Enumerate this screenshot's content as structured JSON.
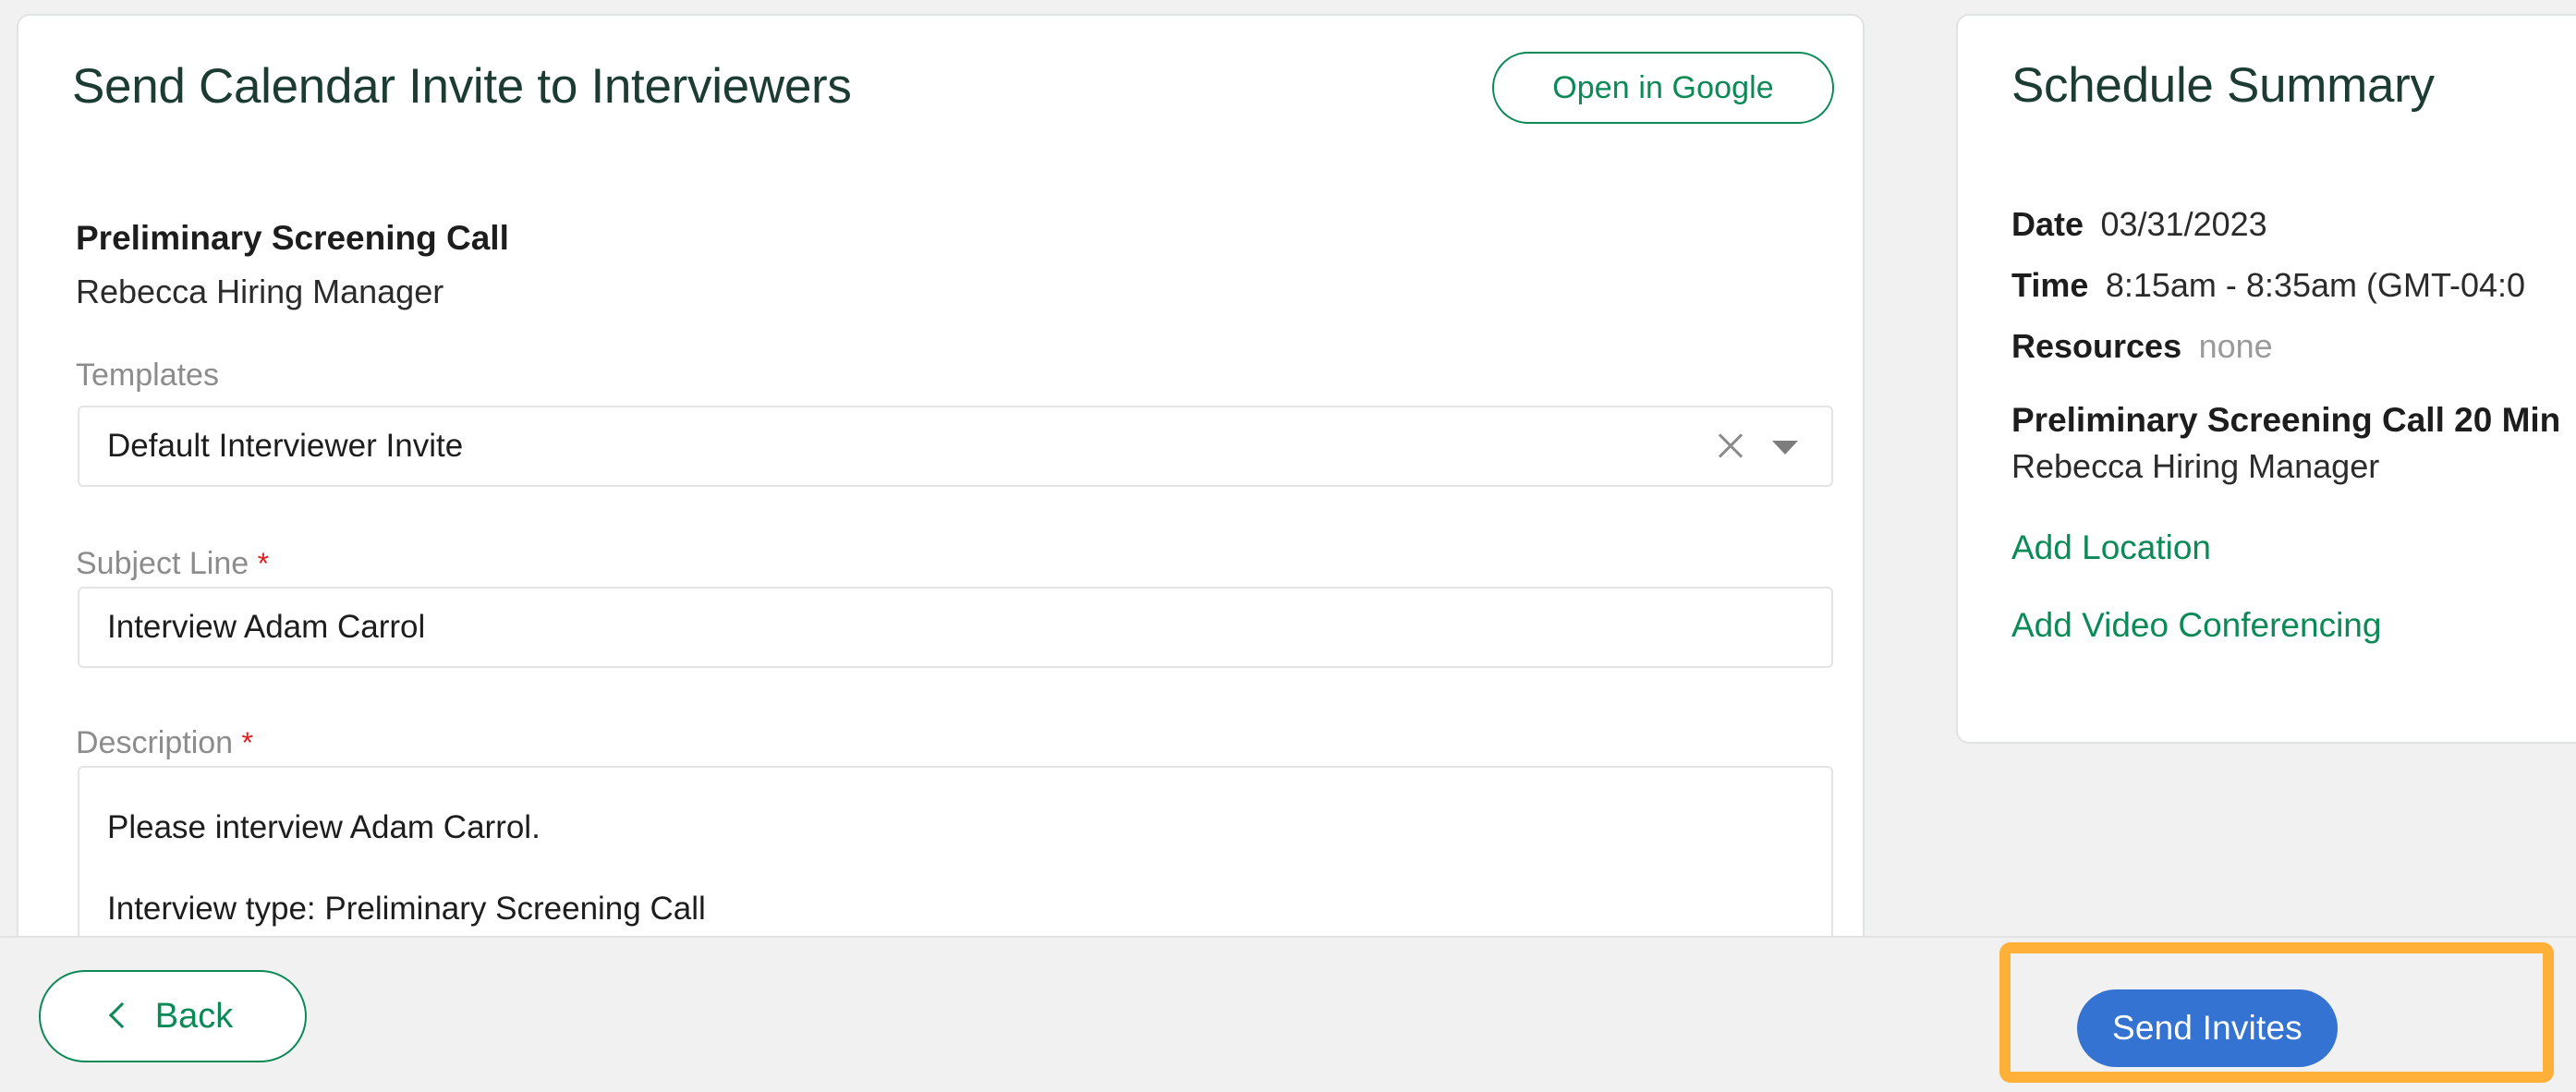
{
  "colors": {
    "heading_green": "#1c3c33",
    "link_green": "#0b8a58",
    "primary_blue": "#3573d2",
    "highlight_orange": "#ffb039",
    "required_red": "#e02020",
    "page_background": "#f1f1f1"
  },
  "main": {
    "title": "Send Calendar Invite to Interviewers",
    "open_in_google_label": "Open in Google",
    "event": {
      "name": "Preliminary Screening Call",
      "organizer": "Rebecca Hiring Manager"
    },
    "templates": {
      "label": "Templates",
      "value": "Default Interviewer Invite",
      "clear_icon": "close-icon",
      "chevron_icon": "chevron-down-icon"
    },
    "subject": {
      "label": "Subject Line",
      "required_marker": "*",
      "value": "Interview Adam Carrol"
    },
    "description": {
      "label": "Description",
      "required_marker": "*",
      "line1": "Please interview Adam Carrol.",
      "line2": "Interview type: Preliminary Screening Call"
    }
  },
  "summary": {
    "title": "Schedule Summary",
    "rows": [
      {
        "key": "Date",
        "value": "03/31/2023",
        "muted": false
      },
      {
        "key": "Time",
        "value": "8:15am - 8:35am (GMT-04:0",
        "muted": false
      },
      {
        "key": "Resources",
        "value": "none",
        "muted": true
      }
    ],
    "block": {
      "title": "Preliminary Screening Call 20 Min",
      "subtitle": "Rebecca Hiring Manager"
    },
    "links": [
      {
        "label": "Add Location"
      },
      {
        "label": "Add Video Conferencing"
      }
    ]
  },
  "footer": {
    "back_label": "Back",
    "back_icon": "chevron-left-icon",
    "send_invites_label": "Send Invites"
  }
}
